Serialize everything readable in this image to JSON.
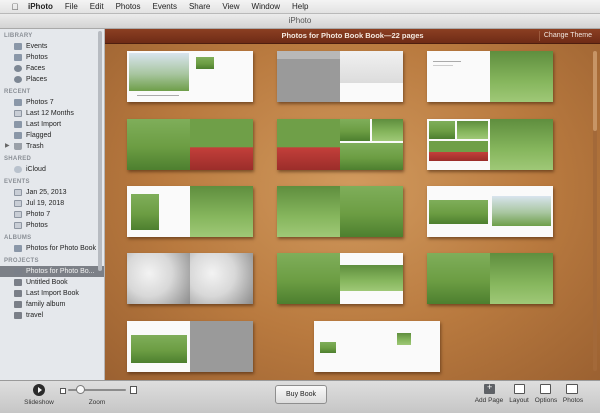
{
  "menubar": {
    "app_name": "iPhoto",
    "items": [
      "File",
      "Edit",
      "Photos",
      "Events",
      "Share",
      "View",
      "Window",
      "Help"
    ]
  },
  "window": {
    "title": "iPhoto"
  },
  "sidebar": {
    "library": {
      "header": "LIBRARY",
      "items": [
        {
          "label": "Events",
          "icon": "events-icon"
        },
        {
          "label": "Photos",
          "icon": "photos-icon"
        },
        {
          "label": "Faces",
          "icon": "faces-icon"
        },
        {
          "label": "Places",
          "icon": "places-icon"
        }
      ]
    },
    "recent": {
      "header": "RECENT",
      "items": [
        {
          "label": "Photos 7",
          "icon": "album-icon"
        },
        {
          "label": "Last 12 Months",
          "icon": "calendar-icon"
        },
        {
          "label": "Last Import",
          "icon": "import-icon"
        },
        {
          "label": "Flagged",
          "icon": "flag-icon"
        },
        {
          "label": "Trash",
          "icon": "trash-icon"
        }
      ]
    },
    "shared": {
      "header": "SHARED",
      "items": [
        {
          "label": "iCloud",
          "icon": "icloud-icon"
        }
      ]
    },
    "events": {
      "header": "EVENTS",
      "items": [
        {
          "label": "Jan 25, 2013",
          "icon": "event-icon"
        },
        {
          "label": "Jul 19, 2018",
          "icon": "event-icon"
        },
        {
          "label": "Photo 7",
          "icon": "event-icon"
        },
        {
          "label": "Photos",
          "icon": "event-icon"
        }
      ]
    },
    "albums": {
      "header": "ALBUMS",
      "items": [
        {
          "label": "Photos for Photo Book",
          "icon": "album-icon"
        }
      ]
    },
    "projects": {
      "header": "PROJECTS",
      "items": [
        {
          "label": "Photos for Photo Bo...",
          "icon": "book-icon",
          "selected": true
        },
        {
          "label": "Untitled Book",
          "icon": "book-icon"
        },
        {
          "label": "Last Import Book",
          "icon": "book-icon"
        },
        {
          "label": "family album",
          "icon": "book-icon"
        },
        {
          "label": "travel",
          "icon": "book-icon"
        }
      ]
    }
  },
  "main": {
    "title": "Photos for Photo Book Book—22 pages",
    "change_theme_label": "Change Theme"
  },
  "toolbar": {
    "slideshow_label": "Slideshow",
    "zoom_label": "Zoom",
    "zoom_level": 0.15,
    "buy_book_label": "Buy Book",
    "add_page_label": "Add Page",
    "layout_label": "Layout",
    "options_label": "Options",
    "photos_label": "Photos"
  }
}
